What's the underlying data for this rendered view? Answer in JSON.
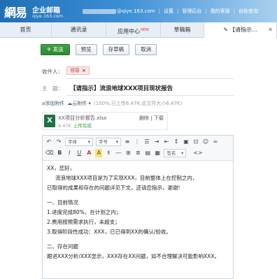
{
  "brand": {
    "logo": "網易",
    "name": "企业邮箱",
    "domain": "qiye.163.com",
    "logo_alt": "NetEase logo"
  },
  "topnav": {
    "user_email": "@qiye.163.com",
    "links": [
      "设置",
      "管理后台",
      "我的客服",
      "自助查询"
    ]
  },
  "tabs": [
    {
      "label": "首页"
    },
    {
      "label": "通讯录"
    },
    {
      "label": "应用中心",
      "badge": "NEW"
    },
    {
      "label": "草稿箱"
    },
    {
      "label": "【请指示...",
      "active": true
    }
  ],
  "toolbar": {
    "send": "发送",
    "preview": "预览",
    "save_draft": "存草稿",
    "cancel": "取消"
  },
  "compose": {
    "to_label": "收件人：",
    "recipient": "领导",
    "subject_label": "主　题：",
    "subject": "【请指示】流浪地球XXX项目现状报告",
    "add_attachment": "添加附件",
    "cloud_attachment": "云附件",
    "attachment_summary": "(100%,已上传6.47K,总文件大小6.47K)"
  },
  "attachment": {
    "icon": "excel-icon",
    "icon_letter": "X",
    "filename": "XX项目分析报告.xlsx",
    "size": "6.47K",
    "status": "上传完成",
    "delete": "删除",
    "download": "下载"
  },
  "editor": {
    "font_family": "字体",
    "font_size": "字号",
    "signature": "签名"
  },
  "body": {
    "greeting": "XX，您好，",
    "p1": "流浪地球XXX项目是为了实现XXX，目前整体上在控制之内，",
    "p2": "已取得的成果和存在的问题详见下文，还请您指示，谢谢!",
    "h1": "一、目前情况",
    "item1": "1.进度完成80%，在计划之内；",
    "item2": "2.费用按照需求执行，未超支；",
    "item3": "3.取得阶段性成功：XXX，已已得到XX的确认/验收。",
    "h2": "二、存在问题",
    "p3": "跟进XXX分析/XXX显示，XXX存在XX问题，如不合理解决可能影响XXX。"
  },
  "colors": {
    "header_start": "#1f6fb5",
    "header_end": "#a9d0ef",
    "send_button": "#2b8a30",
    "recipient_tag": "#fde8e8",
    "upload_ok": "#2f9e3a"
  }
}
